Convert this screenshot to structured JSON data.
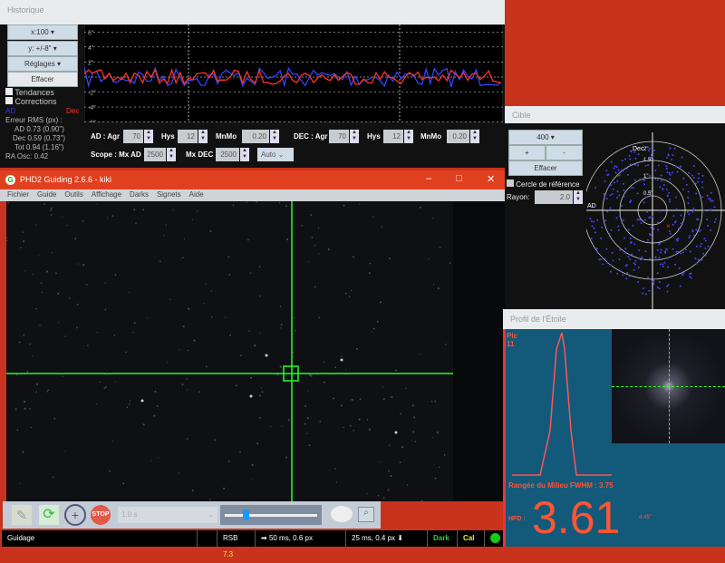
{
  "history": {
    "title": "Historique",
    "x_scale": "x:100",
    "y_scale": "y: +/-8\"",
    "settings": "Réglages",
    "clear": "Effacer",
    "trends": "Tendances",
    "corrections": "Corrections",
    "ra_label": "AD",
    "dec_label": "Dec",
    "y_ticks": [
      "6\"",
      "4\"",
      "2\"",
      "-2\"",
      "-4\"",
      "-6\""
    ],
    "rms_title": "Erreur RMS (px) :",
    "rms_ra": "AD 0.73 (0.90\")",
    "rms_dec": "Dec 0.59 (0.73\")",
    "rms_tot": "Tot 0.94 (1.16\")",
    "ra_osc": "RA Osc: 0.42",
    "ra_ctrl": "AD : Agr",
    "hys": "Hys",
    "minmo": "MnMo",
    "dec_ctrl": "DEC : Agr",
    "scope_ctrl": "Scope : Mx AD",
    "mx_dec": "Mx DEC",
    "ra_agr": "70",
    "ra_hys": "12",
    "ra_minmo": "0.20",
    "dec_agr": "70",
    "dec_hys": "12",
    "dec_minmo": "0.20",
    "mx_ra_val": "2500",
    "mx_dec_val": "2500",
    "dec_mode": "Auto",
    "colors": {
      "ra": "#3344ff",
      "dec": "#ff3322"
    }
  },
  "main": {
    "title": "PHD2 Guiding 2.6.6 - kiki",
    "menu": [
      "Fichier",
      "Guide",
      "Outils",
      "Affichage",
      "Darks",
      "Signets",
      "Aide"
    ],
    "exposure": "1.0 s",
    "status": "Guidage",
    "snr_label": "RSB",
    "snr": "7.3",
    "ra_pulse": "50 ms, 0.6 px",
    "dec_pulse": "25 ms, 0.4 px",
    "dark": "Dark",
    "cal": "Cal"
  },
  "target": {
    "title": "Cible",
    "length": "400",
    "plus": "+",
    "minus": "-",
    "clear": "Effacer",
    "ref_circle": "Cercle de référence",
    "radius_label": "Rayon:",
    "radius": "2.0",
    "dec_axis": "Dec",
    "ra_axis": "AD",
    "rings": [
      "2\"",
      "1.5\"",
      "1\"",
      "0.5\""
    ]
  },
  "profile": {
    "title": "Profil de l'Étoile",
    "peak_label": "Pic",
    "peak": "11",
    "fwhm": "Rangée du Milieu FWHM : 3.75",
    "hfd_label": "HFD :",
    "hfd": "3.61",
    "hfd_arcsec": "4.45\""
  }
}
